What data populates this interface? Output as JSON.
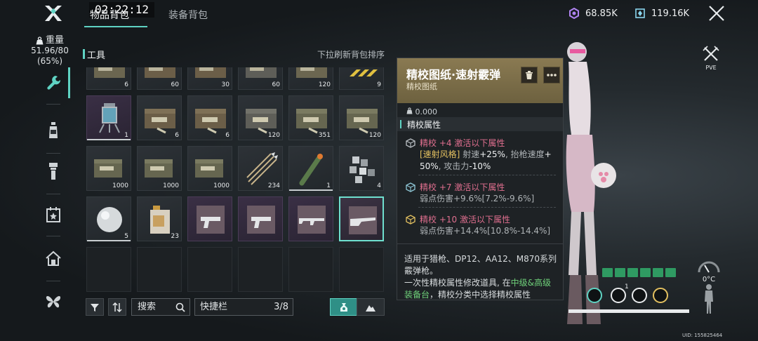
{
  "header": {
    "clock": "02:22:12",
    "tabs": [
      {
        "label": "物品背包",
        "active": true
      },
      {
        "label": "装备背包",
        "active": false
      }
    ],
    "currencies": [
      {
        "icon": "energy-coin-icon",
        "value": "68.85K",
        "color": "#b084f0"
      },
      {
        "icon": "crystal-icon",
        "value": "119.16K",
        "color": "#8ad6ee"
      }
    ]
  },
  "sidebar": {
    "weight_label": "重量",
    "weight_value": "51.96/80",
    "weight_percent": "(65%)",
    "items": [
      {
        "icon": "wrench-icon",
        "active": true
      },
      {
        "icon": "bottle-icon",
        "active": false
      },
      {
        "icon": "flashlight-icon",
        "active": false
      },
      {
        "icon": "calendar-star-icon",
        "active": false
      },
      {
        "icon": "home-icon",
        "active": false
      },
      {
        "icon": "butterfly-icon",
        "active": false
      }
    ]
  },
  "inventory": {
    "section_title": "工具",
    "sort_hint": "下拉刷新背包排序",
    "rows": [
      [
        {
          "item": "ammo-crate-icon",
          "count": "6",
          "rarity": "common"
        },
        {
          "item": "ammo-crate-icon",
          "count": "60",
          "rarity": "common"
        },
        {
          "item": "ammo-crate-icon",
          "count": "30",
          "rarity": "common"
        },
        {
          "item": "ammo-crate-icon",
          "count": "60",
          "rarity": "common"
        },
        {
          "item": "ammo-crate-icon",
          "count": "120",
          "rarity": "common"
        },
        {
          "item": "hazard-tape-icon",
          "count": "9",
          "rarity": "common"
        }
      ],
      [
        {
          "item": "lantern-device-icon",
          "count": "1",
          "rarity": "rare"
        },
        {
          "item": "ammo-crate-icon",
          "count": "6",
          "rarity": "common"
        },
        {
          "item": "ammo-crate-icon",
          "count": "6",
          "rarity": "common"
        },
        {
          "item": "ammo-crate-icon",
          "count": "120",
          "rarity": "common"
        },
        {
          "item": "ammo-crate-icon",
          "count": "351",
          "rarity": "common"
        },
        {
          "item": "ammo-crate-icon",
          "count": "120",
          "rarity": "common"
        }
      ],
      [
        {
          "item": "ammo-crate-icon",
          "count": "1000",
          "rarity": "common"
        },
        {
          "item": "ammo-crate-icon",
          "count": "1000",
          "rarity": "common"
        },
        {
          "item": "ammo-crate-icon",
          "count": "1000",
          "rarity": "common"
        },
        {
          "item": "arrows-icon",
          "count": "234",
          "rarity": "common"
        },
        {
          "item": "firework-icon",
          "count": "1",
          "rarity": "common"
        },
        {
          "item": "cubes-icon",
          "count": "4",
          "rarity": "common"
        }
      ],
      [
        {
          "item": "orb-icon",
          "count": "5",
          "rarity": "common"
        },
        {
          "item": "fuel-jug-icon",
          "count": "23",
          "rarity": "common"
        },
        {
          "item": "pistol-blueprint-icon",
          "count": "",
          "rarity": "rare"
        },
        {
          "item": "pistol-blueprint-icon",
          "count": "",
          "rarity": "rare"
        },
        {
          "item": "rifle-blueprint-icon",
          "count": "",
          "rarity": "rare"
        },
        {
          "item": "shotgun-blueprint-icon",
          "count": "",
          "rarity": "rare",
          "selected": true
        }
      ]
    ]
  },
  "toolbar": {
    "search_label": "搜索",
    "quickbar_label": "快捷栏",
    "quickbar_count": "3/8"
  },
  "tooltip": {
    "title": "精校图纸·速射霰弹",
    "subtitle": "精校图纸",
    "weight": "0.000",
    "section_title": "精校属性",
    "tiers": [
      {
        "header": "精校 +4 激活以下属性",
        "tag": "[速射风格]",
        "line1_a": " 射速",
        "line1_b": "+25%",
        "line1_c": ", 抬枪速度",
        "line1_d": "+",
        "line2_a": "50%",
        "line2_b": ", 攻击力",
        "line2_c": "-10%"
      },
      {
        "header": "精校 +7 激活以下属性",
        "body": "弱点伤害+9.6%[7.2%-9.6%]"
      },
      {
        "header": "精校 +10 激活以下属性",
        "body": "弱点伤害+14.4%[10.8%-14.4%]"
      }
    ],
    "desc_line1": "适用于猎枪、DP12、AA12、M870系列",
    "desc_line2": "霰弹枪。",
    "desc_line3": "一次性精校属性修改道具, 在",
    "desc_highlight": "中级&高级",
    "desc_line4": "装备台",
    "desc_line4b": "，精校分类中选择精校属性",
    "tier_color": "#e06f8f",
    "accent": "#5fd3c3"
  },
  "right_panel": {
    "mode_label": "PVE",
    "temperature": "0°C",
    "uid": "UID: 155825464",
    "buff_value": "1"
  }
}
